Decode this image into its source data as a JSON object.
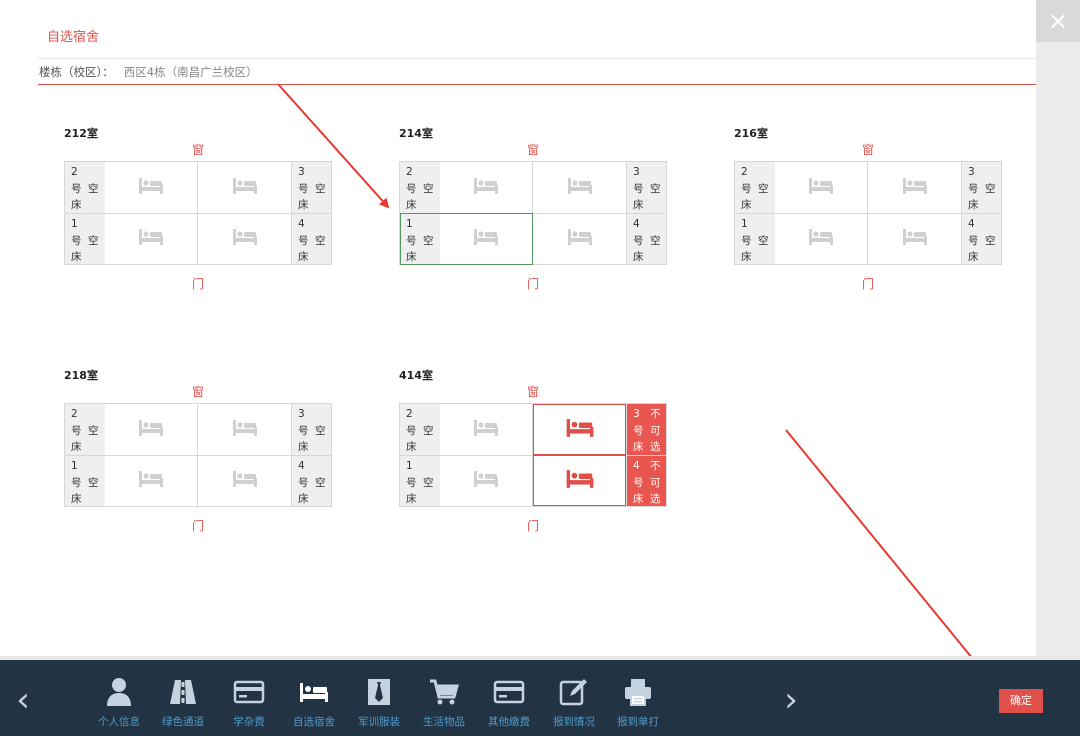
{
  "dialog": {
    "title": "自选宿舍",
    "close_label": "×"
  },
  "building": {
    "label": "楼栋（校区）：",
    "value": "西区4栋（南昌广兰校区）"
  },
  "common": {
    "window": "窗",
    "door": "门",
    "hao": "号",
    "chuang": "床",
    "empty": "空",
    "unavailable": [
      "不",
      "可",
      "选"
    ]
  },
  "rooms": [
    {
      "name": "212室",
      "beds": [
        {
          "num": "2",
          "status": "空床"
        },
        {
          "num": "3",
          "status": "空床"
        },
        {
          "num": "1",
          "status": "空床"
        },
        {
          "num": "4",
          "status": "空床"
        }
      ]
    },
    {
      "name": "214室",
      "selected_bed": "1",
      "beds": [
        {
          "num": "2",
          "status": "空床"
        },
        {
          "num": "3",
          "status": "空床"
        },
        {
          "num": "1",
          "status": "空床"
        },
        {
          "num": "4",
          "status": "空床"
        }
      ]
    },
    {
      "name": "216室",
      "beds": [
        {
          "num": "2",
          "status": "空床"
        },
        {
          "num": "3",
          "status": "空床"
        },
        {
          "num": "1",
          "status": "空床"
        },
        {
          "num": "4",
          "status": "空床"
        }
      ]
    },
    {
      "name": "218室",
      "beds": [
        {
          "num": "2",
          "status": "空床"
        },
        {
          "num": "3",
          "status": "空床"
        },
        {
          "num": "1",
          "status": "空床"
        },
        {
          "num": "4",
          "status": "空床"
        }
      ]
    },
    {
      "name": "414室",
      "beds": [
        {
          "num": "2",
          "status": "空床"
        },
        {
          "num": "3",
          "status": "不可选"
        },
        {
          "num": "1",
          "status": "空床"
        },
        {
          "num": "4",
          "status": "不可选"
        }
      ]
    }
  ],
  "nav": {
    "prev": "‹",
    "next": "›",
    "items": [
      {
        "label": "个人信息",
        "icon": "person-icon"
      },
      {
        "label": "绿色通道",
        "icon": "road-icon"
      },
      {
        "label": "学杂费",
        "icon": "card-icon"
      },
      {
        "label": "自选宿舍",
        "icon": "bed-icon"
      },
      {
        "label": "军训服装",
        "icon": "tie-icon"
      },
      {
        "label": "生活物品",
        "icon": "cart-icon"
      },
      {
        "label": "其他缴费",
        "icon": "card-icon"
      },
      {
        "label": "报到情况",
        "icon": "edit-icon"
      },
      {
        "label": "报到单打",
        "icon": "printer-icon"
      }
    ]
  },
  "confirm_label": "确定",
  "colors": {
    "accent": "#e0504a",
    "bar": "#223344",
    "selected": "#4f9a5a",
    "nav_label": "#4f9ac8"
  }
}
